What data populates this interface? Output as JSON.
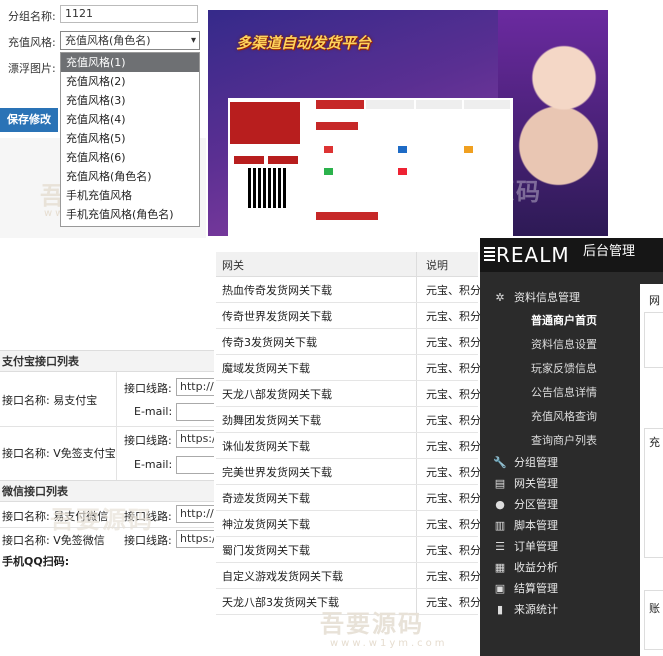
{
  "group_form": {
    "name_label": "分组名称:",
    "name_value": "1121",
    "style_label": "充值风格:",
    "style_selected": "充值风格(角色名)",
    "float_label": "漂浮图片:",
    "save_button": "保存修改",
    "options": [
      "充值风格(1)",
      "充值风格(2)",
      "充值风格(3)",
      "充值风格(4)",
      "充值风格(5)",
      "充值风格(6)",
      "充值风格(角色名)",
      "手机充值风格",
      "手机充值风格(角色名)"
    ]
  },
  "banner": {
    "title": "多渠道自动发货平台"
  },
  "gateway_table": {
    "col_gateway": "网关",
    "col_desc": "说明",
    "rows": [
      {
        "name": "热血传奇发货网关下载",
        "desc": "元宝、积分"
      },
      {
        "name": "传奇世界发货网关下载",
        "desc": "元宝、积分"
      },
      {
        "name": "传奇3发货网关下载",
        "desc": "元宝、积分"
      },
      {
        "name": "魔域发货网关下载",
        "desc": "元宝、积分"
      },
      {
        "name": "天龙八部发货网关下载",
        "desc": "元宝、积分"
      },
      {
        "name": "劲舞团发货网关下载",
        "desc": "元宝、积分"
      },
      {
        "name": "诛仙发货网关下载",
        "desc": "元宝、积分"
      },
      {
        "name": "完美世界发货网关下载",
        "desc": "元宝、积分"
      },
      {
        "name": "奇迹发货网关下载",
        "desc": "元宝、积分"
      },
      {
        "name": "神泣发货网关下载",
        "desc": "元宝、积分"
      },
      {
        "name": "蜀门发货网关下载",
        "desc": "元宝、积分"
      },
      {
        "name": "自定义游戏发货网关下载",
        "desc": "元宝、积分"
      },
      {
        "name": "天龙八部3发货网关下载",
        "desc": "元宝、积分"
      }
    ]
  },
  "payment_list": {
    "alipay_header": "支付宝接口列表",
    "wechat_header": "微信接口列表",
    "qq_header": "手机QQ扫码:",
    "line_label": "接口线路:",
    "email_label": "E-mail:",
    "alipay_items": [
      {
        "name": "接口名称:  易支付宝",
        "line_value": "http://p"
      },
      {
        "name": "接口名称:  V免签支付宝",
        "line_value": "https://"
      }
    ],
    "wechat_items": [
      {
        "name": "接口名称:  易支付微信",
        "line_value": "http://p"
      },
      {
        "name": "接口名称:  V免签微信",
        "line_value": "https://"
      }
    ]
  },
  "admin": {
    "logo": "REALM",
    "title": "后台管理",
    "menu": [
      {
        "icon": "gear-icon",
        "glyph": "✲",
        "label": "资料信息管理",
        "submenu": [
          {
            "label": "普通商户首页",
            "active": true
          },
          {
            "label": "资料信息设置",
            "active": false
          },
          {
            "label": "玩家反馈信息",
            "active": false
          },
          {
            "label": "公告信息详情",
            "active": false
          },
          {
            "label": "充值风格查询",
            "active": false
          },
          {
            "label": "查询商户列表",
            "active": false
          }
        ]
      },
      {
        "icon": "wrench-icon",
        "glyph": "🔧",
        "label": "分组管理"
      },
      {
        "icon": "clipboard-icon",
        "glyph": "▤",
        "label": "网关管理"
      },
      {
        "icon": "user-icon",
        "glyph": "●",
        "label": "分区管理"
      },
      {
        "icon": "file-icon",
        "glyph": "▥",
        "label": "脚本管理"
      },
      {
        "icon": "list-icon",
        "glyph": "☰",
        "label": "订单管理"
      },
      {
        "icon": "table-icon",
        "glyph": "▦",
        "label": "收益分析"
      },
      {
        "icon": "calculator-icon",
        "glyph": "▣",
        "label": "结算管理"
      },
      {
        "icon": "bar-chart-icon",
        "glyph": "▮",
        "label": "来源统计"
      }
    ],
    "right_fragments": [
      "网",
      "充",
      "账"
    ]
  },
  "watermark": {
    "text": "吾要源码",
    "sub": "www.w1ym.com"
  }
}
